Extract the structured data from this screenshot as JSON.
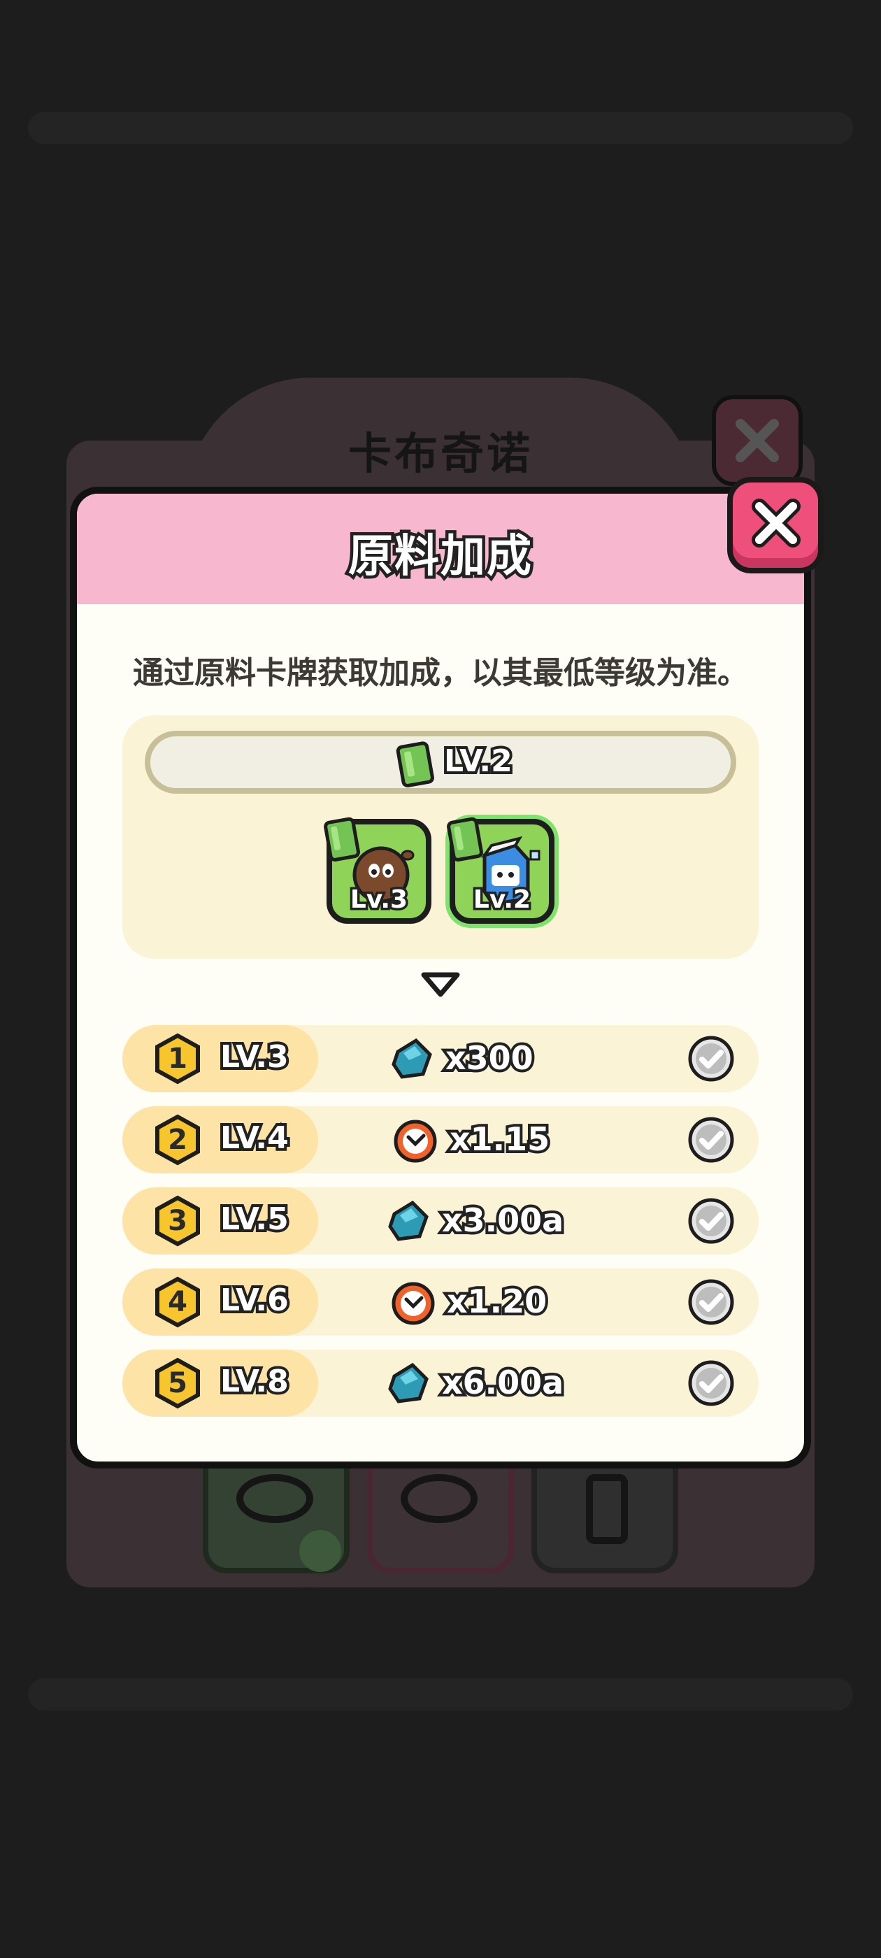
{
  "background": {
    "window_title": "卡布奇诺"
  },
  "modal": {
    "title": "原料加成",
    "description": "通过原料卡牌获取加成，以其最低等级为准。",
    "current_level": "LV.2",
    "ingredient_cards": [
      {
        "name": "coffee-bean",
        "level": "Lv.3",
        "selected": false
      },
      {
        "name": "milk-carton",
        "level": "Lv.2",
        "selected": true
      }
    ],
    "bonus_rows": [
      {
        "index": "1",
        "level": "LV.3",
        "reward_icon": "gem-icon",
        "reward": "x300",
        "claimed": true
      },
      {
        "index": "2",
        "level": "LV.4",
        "reward_icon": "clock-icon",
        "reward": "x1.15",
        "claimed": true
      },
      {
        "index": "3",
        "level": "LV.5",
        "reward_icon": "gem-icon",
        "reward": "x3.00a",
        "claimed": true
      },
      {
        "index": "4",
        "level": "LV.6",
        "reward_icon": "clock-icon",
        "reward": "x1.20",
        "claimed": true
      },
      {
        "index": "5",
        "level": "LV.8",
        "reward_icon": "gem-icon",
        "reward": "x6.00a",
        "claimed": true
      }
    ]
  },
  "colors": {
    "header_pink": "#f7b8cf",
    "close_red": "#ee4f7b",
    "card_green": "#8fd359",
    "row_bg": "#fbf3d5",
    "row_level_bg": "#fde3a6"
  }
}
